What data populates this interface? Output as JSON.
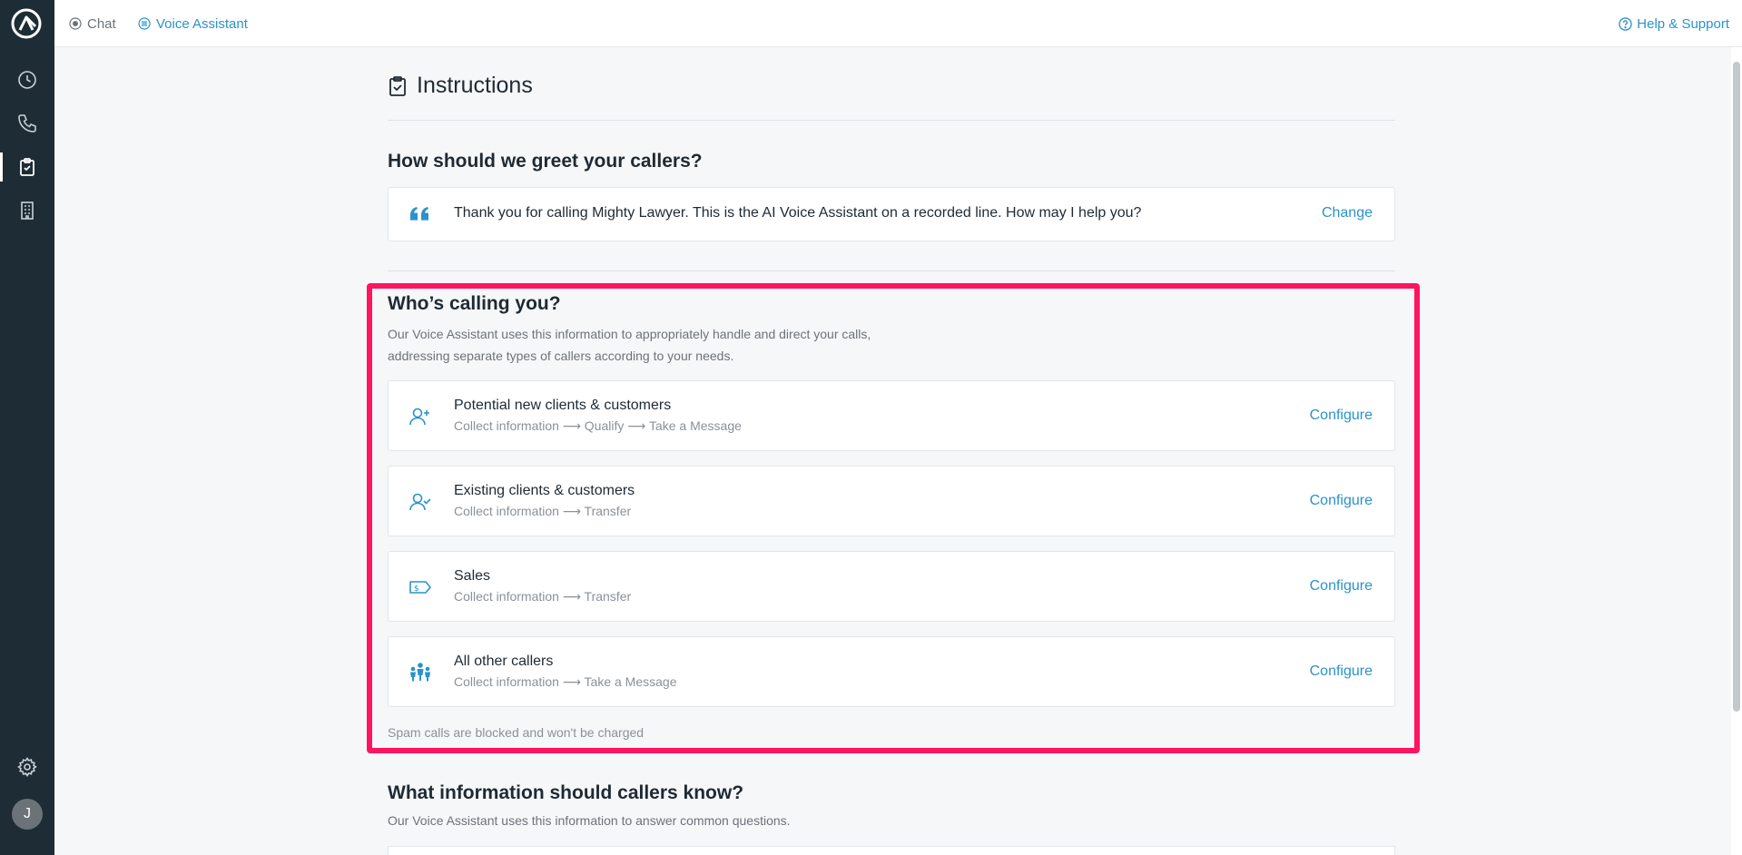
{
  "topbar": {
    "tabs": [
      {
        "label": "Chat",
        "icon": "chat-dot-icon"
      },
      {
        "label": "Voice Assistant",
        "icon": "grid-icon",
        "active": true
      }
    ],
    "help_label": "Help & Support"
  },
  "sidebar": {
    "items": [
      "history-clock-icon",
      "phone-icon",
      "clipboard-check-icon",
      "building-icon"
    ],
    "active": "clipboard-check-icon",
    "bottom": [
      "settings-gear-icon"
    ],
    "avatar_initial": "J"
  },
  "page": {
    "title": "Instructions",
    "greeting": {
      "heading": "How should we greet your callers?",
      "message": "Thank you for calling Mighty Lawyer. This is the AI Voice Assistant on a recorded line. How may I help you?",
      "action_label": "Change"
    },
    "callers": {
      "heading": "Who’s calling you?",
      "desc_line1": "Our Voice Assistant uses this information to appropriately handle and direct your calls,",
      "desc_line2": "addressing separate types of callers according to your needs.",
      "items": [
        {
          "title": "Potential new clients & customers",
          "flow": "Collect information ⟶ Qualify ⟶ Take a Message",
          "action": "Configure",
          "icon": "user-plus-icon"
        },
        {
          "title": "Existing clients & customers",
          "flow": "Collect information ⟶ Transfer",
          "action": "Configure",
          "icon": "user-check-icon"
        },
        {
          "title": "Sales",
          "flow": "Collect information ⟶ Transfer",
          "action": "Configure",
          "icon": "price-tag-icon"
        },
        {
          "title": "All other callers",
          "flow": "Collect information ⟶ Take a Message",
          "action": "Configure",
          "icon": "people-group-icon"
        }
      ],
      "spam_note": "Spam calls are blocked and won't be charged"
    },
    "info": {
      "heading": "What information should callers know?",
      "desc": "Our Voice Assistant uses this information to answer common questions."
    }
  },
  "colors": {
    "sidebar_bg": "#1e2d35",
    "accent": "#2a93c9",
    "highlight": "#ff1460",
    "page_bg": "#f6f7f9"
  }
}
